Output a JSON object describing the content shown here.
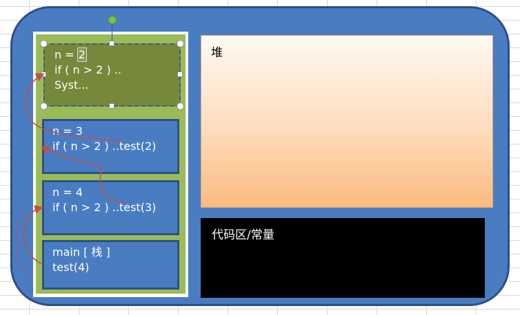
{
  "stack": {
    "frames": [
      {
        "lines": [
          "n  = ",
          "if ( n > 2 ) ..",
          "Syst..."
        ],
        "highlight": "2"
      },
      {
        "lines": [
          "n  = 3",
          "if ( n > 2 ) ..test(2)"
        ]
      },
      {
        "lines": [
          "n  = 4",
          "if ( n > 2 ) ..test(3)"
        ]
      },
      {
        "lines": [
          "main [ 栈 ]",
          "test(4)"
        ]
      }
    ]
  },
  "heap": {
    "label": "堆"
  },
  "code_area": {
    "label": "代码区/常量"
  },
  "colors": {
    "outer_bg": "#4a7cc2",
    "stack_bg": "#9bbb59",
    "frame_bg": "#4a7cc2",
    "active_frame_bg": "#76893b",
    "heap_gradient_end": "#fbba7f",
    "code_bg": "#000000",
    "arrow": "#c0504d"
  }
}
